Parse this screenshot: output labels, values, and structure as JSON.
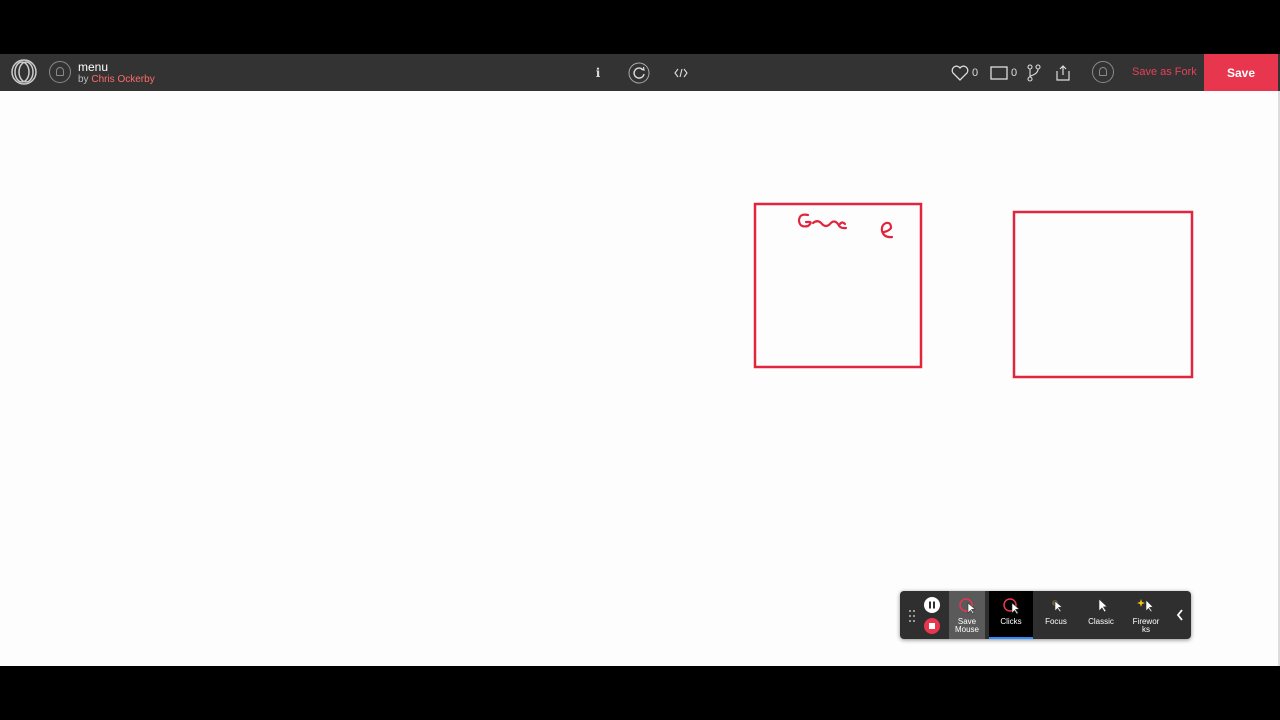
{
  "header": {
    "title": "menu",
    "by_prefix": "by",
    "author": "Chris Ockerby",
    "info_label": "i",
    "likes_count": "0",
    "comments_count": "0",
    "save_as_fork_label": "Save as Fork",
    "save_label": "Save",
    "accent_color": "#e8364f"
  },
  "canvas": {
    "box_color": "#e0263e",
    "handwriting": "Ga e"
  },
  "recorder": {
    "tools": [
      {
        "label": "Save Mouse",
        "icon": "save-mouse-icon"
      },
      {
        "label": "Clicks",
        "icon": "clicks-icon"
      },
      {
        "label": "Focus",
        "icon": "focus-icon"
      },
      {
        "label": "Classic",
        "icon": "classic-cursor-icon"
      },
      {
        "label": "Firewor ks",
        "icon": "fireworks-icon"
      }
    ]
  }
}
